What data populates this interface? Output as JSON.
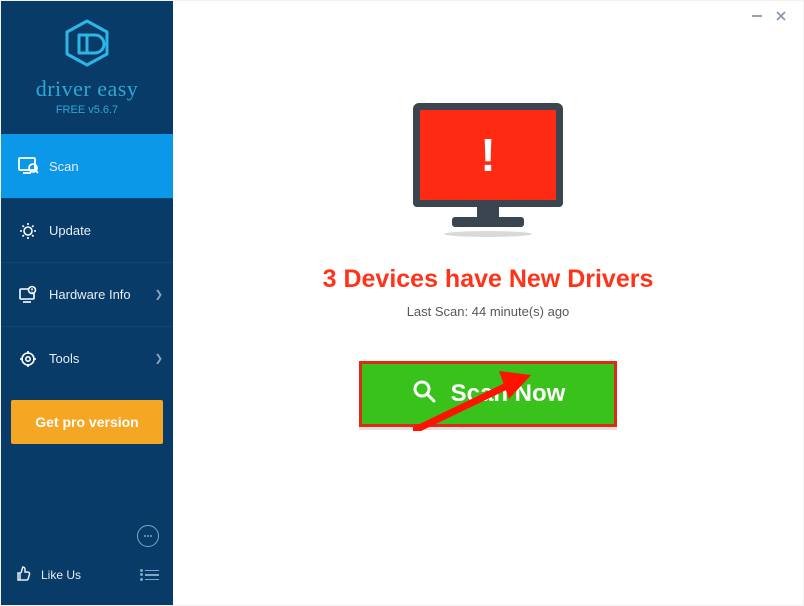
{
  "brand": {
    "name": "driver easy",
    "version_label": "FREE v5.6.7"
  },
  "sidebar": {
    "items": [
      {
        "label": "Scan",
        "icon": "scan-icon",
        "active": true,
        "has_sub": false
      },
      {
        "label": "Update",
        "icon": "update-icon",
        "active": false,
        "has_sub": false
      },
      {
        "label": "Hardware Info",
        "icon": "hardware-icon",
        "active": false,
        "has_sub": true
      },
      {
        "label": "Tools",
        "icon": "tools-icon",
        "active": false,
        "has_sub": true
      }
    ],
    "pro_button": "Get pro version",
    "like_label": "Like Us"
  },
  "main": {
    "headline": "3 Devices have New Drivers",
    "last_scan_label": "Last Scan: 44 minute(s) ago",
    "scan_button_label": "Scan Now"
  },
  "colors": {
    "accent": "#0c98e8",
    "sidebar_bg": "#083b67",
    "pro": "#f5a623",
    "alert": "#ff2a12",
    "scan_green": "#38c21b",
    "highlight_border": "#e02a14"
  }
}
